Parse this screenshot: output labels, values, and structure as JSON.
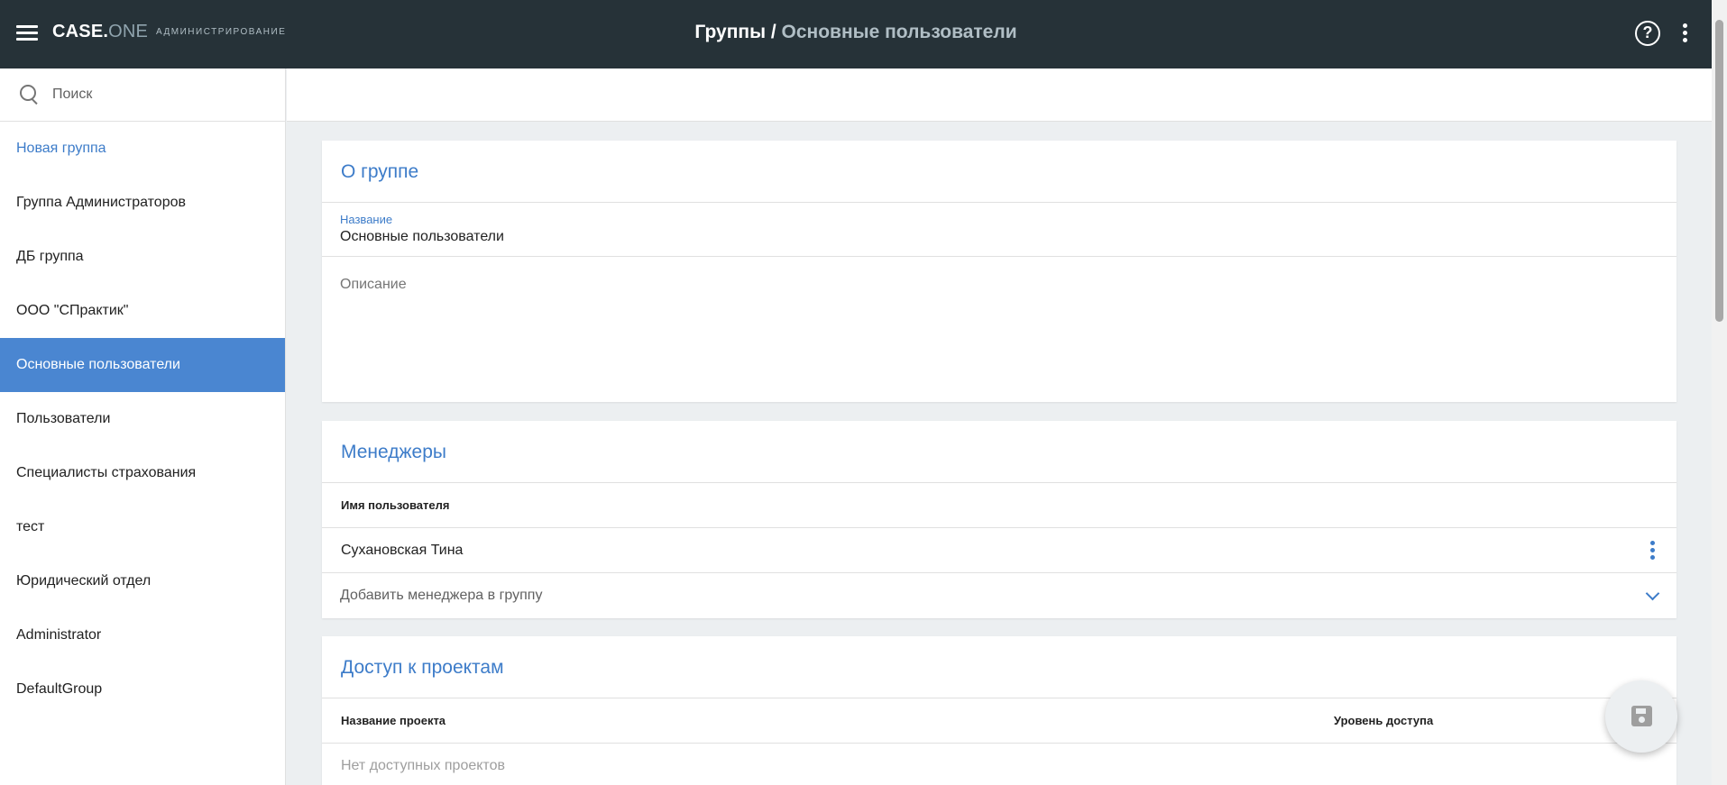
{
  "header": {
    "logo_main": "CASE.",
    "logo_accent": "ONE",
    "logo_sub": "Администрирование",
    "breadcrumb_parent": "Группы",
    "breadcrumb_sep": " / ",
    "breadcrumb_current": "Основные пользователи",
    "help_glyph": "?"
  },
  "sidebar": {
    "search_placeholder": "Поиск",
    "items": [
      {
        "label": "Новая группа"
      },
      {
        "label": "Группа Администраторов"
      },
      {
        "label": "ДБ группа"
      },
      {
        "label": "ООО \"СПрактик\""
      },
      {
        "label": "Основные пользователи",
        "active": true
      },
      {
        "label": "Пользователи"
      },
      {
        "label": "Специалисты страхования"
      },
      {
        "label": "тест"
      },
      {
        "label": "Юридический отдел"
      },
      {
        "label": "Administrator"
      },
      {
        "label": "DefaultGroup"
      }
    ]
  },
  "about": {
    "title": "О группе",
    "name_label": "Название",
    "name_value": "Основные пользователи",
    "description_placeholder": "Описание"
  },
  "managers": {
    "title": "Менеджеры",
    "column_username": "Имя пользователя",
    "rows": [
      {
        "name": "Сухановская Тина"
      }
    ],
    "add_placeholder": "Добавить менеджера в группу"
  },
  "projects": {
    "title": "Доступ к проектам",
    "column_project": "Название проекта",
    "column_access": "Уровень доступа",
    "empty_text": "Нет доступных проектов"
  },
  "colors": {
    "topbar": "#263238",
    "accent": "#3d7cc9",
    "active_item": "#4a86d1",
    "background": "#eceff1"
  }
}
